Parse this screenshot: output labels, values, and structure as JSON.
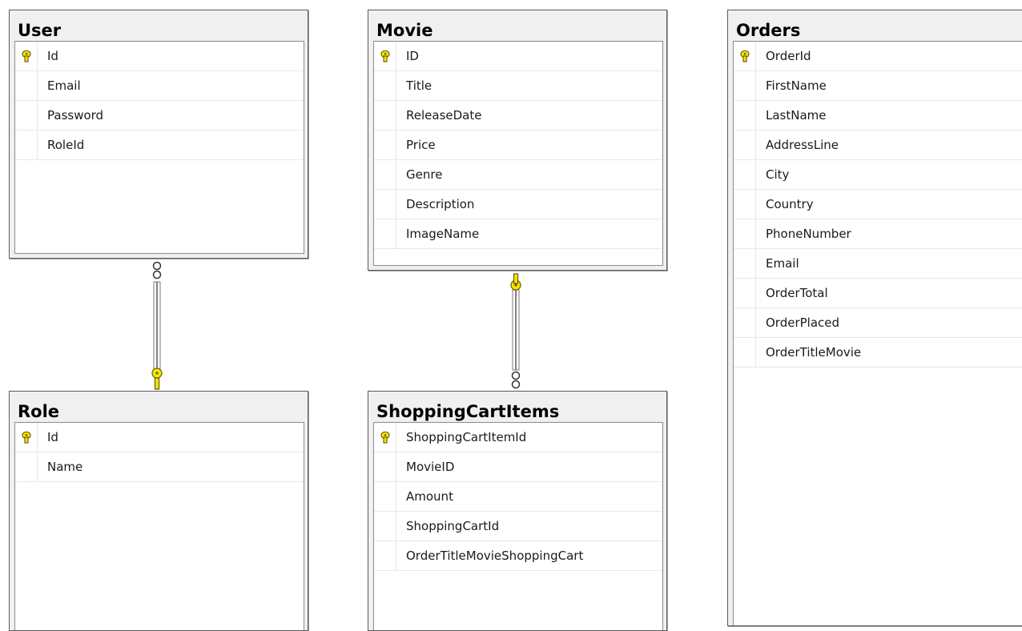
{
  "tables": {
    "user": {
      "title": "User",
      "columns": [
        {
          "name": "Id",
          "primary_key": true
        },
        {
          "name": "Email",
          "primary_key": false
        },
        {
          "name": "Password",
          "primary_key": false
        },
        {
          "name": "RoleId",
          "primary_key": false
        }
      ]
    },
    "movie": {
      "title": "Movie",
      "columns": [
        {
          "name": "ID",
          "primary_key": true
        },
        {
          "name": "Title",
          "primary_key": false
        },
        {
          "name": "ReleaseDate",
          "primary_key": false
        },
        {
          "name": "Price",
          "primary_key": false
        },
        {
          "name": "Genre",
          "primary_key": false
        },
        {
          "name": "Description",
          "primary_key": false
        },
        {
          "name": "ImageName",
          "primary_key": false
        }
      ]
    },
    "orders": {
      "title": "Orders",
      "columns": [
        {
          "name": "OrderId",
          "primary_key": true
        },
        {
          "name": "FirstName",
          "primary_key": false
        },
        {
          "name": "LastName",
          "primary_key": false
        },
        {
          "name": "AddressLine",
          "primary_key": false
        },
        {
          "name": "City",
          "primary_key": false
        },
        {
          "name": "Country",
          "primary_key": false
        },
        {
          "name": "PhoneNumber",
          "primary_key": false
        },
        {
          "name": "Email",
          "primary_key": false
        },
        {
          "name": "OrderTotal",
          "primary_key": false
        },
        {
          "name": "OrderPlaced",
          "primary_key": false
        },
        {
          "name": "OrderTitleMovie",
          "primary_key": false
        }
      ]
    },
    "role": {
      "title": "Role",
      "columns": [
        {
          "name": "Id",
          "primary_key": true
        },
        {
          "name": "Name",
          "primary_key": false
        }
      ]
    },
    "shopping_cart_items": {
      "title": "ShoppingCartItems",
      "columns": [
        {
          "name": "ShoppingCartItemId",
          "primary_key": true
        },
        {
          "name": "MovieID",
          "primary_key": false
        },
        {
          "name": "Amount",
          "primary_key": false
        },
        {
          "name": "ShoppingCartId",
          "primary_key": false
        },
        {
          "name": "OrderTitleMovieShoppingCart",
          "primary_key": false
        }
      ]
    }
  },
  "relationships": [
    {
      "from": "user",
      "to": "role",
      "from_end": "many",
      "to_end": "one"
    },
    {
      "from": "movie",
      "to": "shopping_cart_items",
      "from_end": "one",
      "to_end": "many"
    }
  ],
  "colors": {
    "key_icon": "#f5e600",
    "key_icon_outline": "#6b5a00",
    "table_frame": "#f0f0f0",
    "border": "#5a5a5a"
  },
  "icons": {
    "primary_key": "key-icon",
    "one_end": "key-icon",
    "many_end": "infinity-icon"
  }
}
